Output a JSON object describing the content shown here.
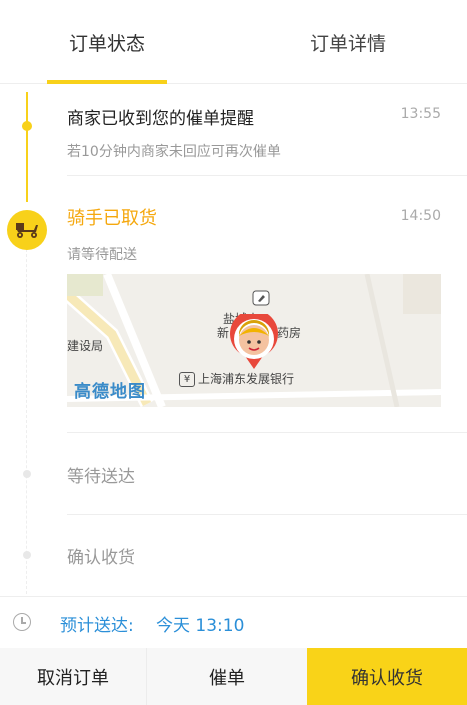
{
  "tabs": [
    {
      "label": "订单状态"
    },
    {
      "label": "订单详情"
    }
  ],
  "timeline": [
    {
      "title": "商家已收到您的催单提醒",
      "subtitle": "若10分钟内商家未回应可再次催单",
      "time": "13:55"
    },
    {
      "title": "骑手已取货",
      "subtitle": "请等待配送",
      "time": "14:50"
    },
    {
      "title": "等待送达"
    },
    {
      "title": "确认收货"
    }
  ],
  "map": {
    "labels": {
      "road": "建设局",
      "poi_top": "盐城南",
      "poi_top_left": "新",
      "poi_right": "药房",
      "bank": "上海浦东发展银行",
      "bank_icon": "¥",
      "logo": "高德地图"
    }
  },
  "eta": {
    "label": "预计送达:",
    "value": "今天 13:10"
  },
  "actions": {
    "cancel": "取消订单",
    "urge": "催单",
    "confirm": "确认收货"
  },
  "colors": {
    "accent": "#f8d11a",
    "active_text": "#f5a80e",
    "eta_blue": "#2b8fd8"
  }
}
